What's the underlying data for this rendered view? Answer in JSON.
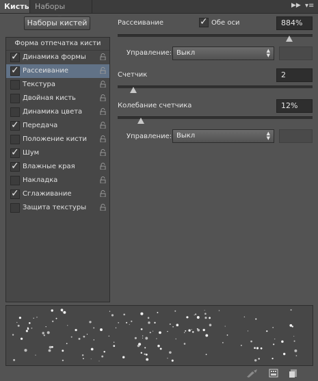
{
  "tabs": [
    {
      "label": "Кисть",
      "active": true
    },
    {
      "label": "Наборы кистей",
      "active": false
    }
  ],
  "panel_controls": {
    "collapse_icon": "double-arrow-right-icon",
    "menu_icon": "panel-menu-icon"
  },
  "presets_button": "Наборы кистей",
  "list": {
    "header": "Форма отпечатка кисти",
    "items": [
      {
        "label": "Динамика формы",
        "checked": true,
        "selected": false
      },
      {
        "label": "Рассеивание",
        "checked": true,
        "selected": true
      },
      {
        "label": "Текстура",
        "checked": false,
        "selected": false
      },
      {
        "label": "Двойная кисть",
        "checked": false,
        "selected": false
      },
      {
        "label": "Динамика цвета",
        "checked": false,
        "selected": false
      },
      {
        "label": "Передача",
        "checked": true,
        "selected": false
      },
      {
        "label": "Положение кисти",
        "checked": false,
        "selected": false
      },
      {
        "label": "Шум",
        "checked": true,
        "selected": false
      },
      {
        "label": "Влажные края",
        "checked": true,
        "selected": false
      },
      {
        "label": "Накладка",
        "checked": false,
        "selected": false
      },
      {
        "label": "Сглаживание",
        "checked": true,
        "selected": false
      },
      {
        "label": "Защита текстуры",
        "checked": false,
        "selected": false
      }
    ]
  },
  "scatter": {
    "label": "Рассеивание",
    "both_axes_label": "Обе оси",
    "both_axes_checked": true,
    "value": "884%",
    "slider_fraction": 0.88,
    "control_label": "Управление:",
    "control_value": "Выкл"
  },
  "count": {
    "label": "Счетчик",
    "value": "2",
    "slider_fraction": 0.08
  },
  "count_jitter": {
    "label": "Колебание счетчика",
    "value": "12%",
    "slider_fraction": 0.12,
    "control_label": "Управление:",
    "control_value": "Выкл"
  },
  "footer_icons": [
    "brush-tool-icon",
    "brush-grid-icon",
    "new-preset-icon"
  ],
  "colors": {
    "selected_row": "#617287",
    "panel_bg": "#535353"
  }
}
